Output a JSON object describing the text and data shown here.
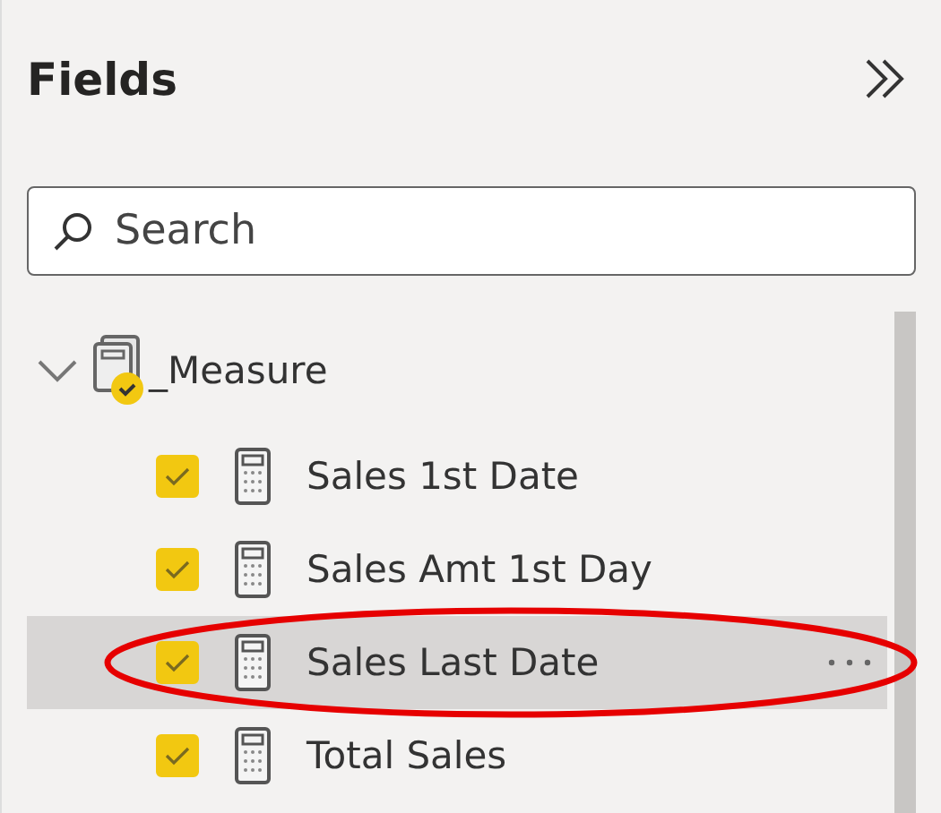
{
  "pane": {
    "title": "Fields"
  },
  "search": {
    "placeholder": "Search"
  },
  "tree": [
    {
      "label": "_Measure",
      "expanded": true,
      "checked": true,
      "children": [
        {
          "label": "Sales 1st Date",
          "checked": true,
          "selected": false,
          "circled": false
        },
        {
          "label": "Sales Amt 1st Day",
          "checked": true,
          "selected": false,
          "circled": false
        },
        {
          "label": "Sales Last Date",
          "checked": true,
          "selected": true,
          "circled": true
        },
        {
          "label": "Total Sales",
          "checked": true,
          "selected": false,
          "circled": false
        }
      ]
    }
  ]
}
